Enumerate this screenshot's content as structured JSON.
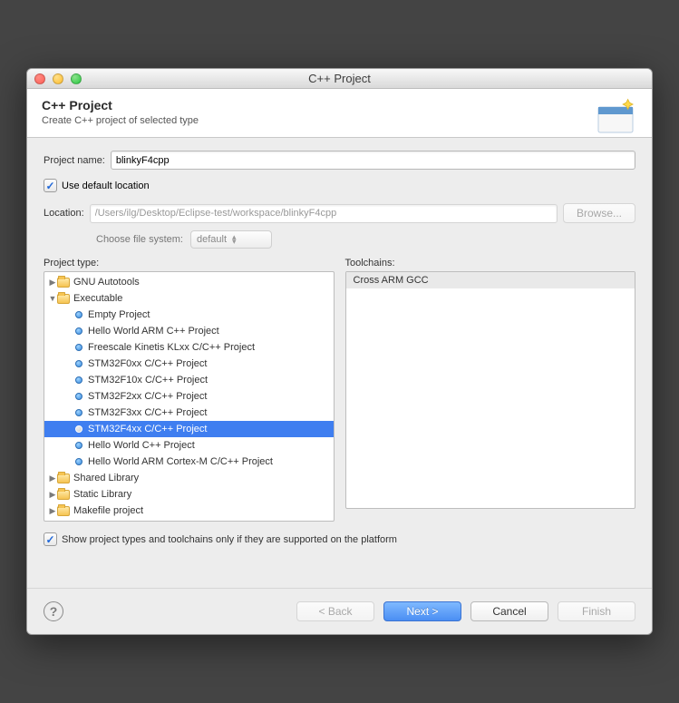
{
  "window": {
    "title": "C++ Project"
  },
  "header": {
    "title": "C++ Project",
    "subtitle": "Create C++ project of selected type"
  },
  "form": {
    "project_name_label": "Project name:",
    "project_name_value": "blinkyF4cpp",
    "use_default_location_label": "Use default location",
    "use_default_location_checked": true,
    "location_label": "Location:",
    "location_value": "/Users/ilg/Desktop/Eclipse-test/workspace/blinkyF4cpp",
    "browse_label": "Browse...",
    "choose_fs_label": "Choose file system:",
    "choose_fs_value": "default"
  },
  "project_type_label": "Project type:",
  "project_type_tree": [
    {
      "level": 0,
      "kind": "folder",
      "expanded": false,
      "label": "GNU Autotools"
    },
    {
      "level": 0,
      "kind": "folder",
      "expanded": true,
      "label": "Executable"
    },
    {
      "level": 1,
      "kind": "leaf",
      "label": "Empty Project"
    },
    {
      "level": 1,
      "kind": "leaf",
      "label": "Hello World ARM C++ Project"
    },
    {
      "level": 1,
      "kind": "leaf",
      "label": "Freescale Kinetis KLxx C/C++ Project"
    },
    {
      "level": 1,
      "kind": "leaf",
      "label": "STM32F0xx C/C++ Project"
    },
    {
      "level": 1,
      "kind": "leaf",
      "label": "STM32F10x C/C++ Project"
    },
    {
      "level": 1,
      "kind": "leaf",
      "label": "STM32F2xx C/C++ Project"
    },
    {
      "level": 1,
      "kind": "leaf",
      "label": "STM32F3xx C/C++ Project"
    },
    {
      "level": 1,
      "kind": "leaf",
      "label": "STM32F4xx C/C++ Project",
      "selected": true
    },
    {
      "level": 1,
      "kind": "leaf",
      "label": "Hello World C++ Project"
    },
    {
      "level": 1,
      "kind": "leaf",
      "label": "Hello World ARM Cortex-M C/C++ Project"
    },
    {
      "level": 0,
      "kind": "folder",
      "expanded": false,
      "label": "Shared Library"
    },
    {
      "level": 0,
      "kind": "folder",
      "expanded": false,
      "label": "Static Library"
    },
    {
      "level": 0,
      "kind": "folder",
      "expanded": false,
      "label": "Makefile project"
    }
  ],
  "toolchains_label": "Toolchains:",
  "toolchains": [
    {
      "label": "Cross ARM GCC",
      "selected": true
    }
  ],
  "show_supported_label": "Show project types and toolchains only if they are supported on the platform",
  "show_supported_checked": true,
  "buttons": {
    "back": "< Back",
    "next": "Next >",
    "cancel": "Cancel",
    "finish": "Finish"
  }
}
